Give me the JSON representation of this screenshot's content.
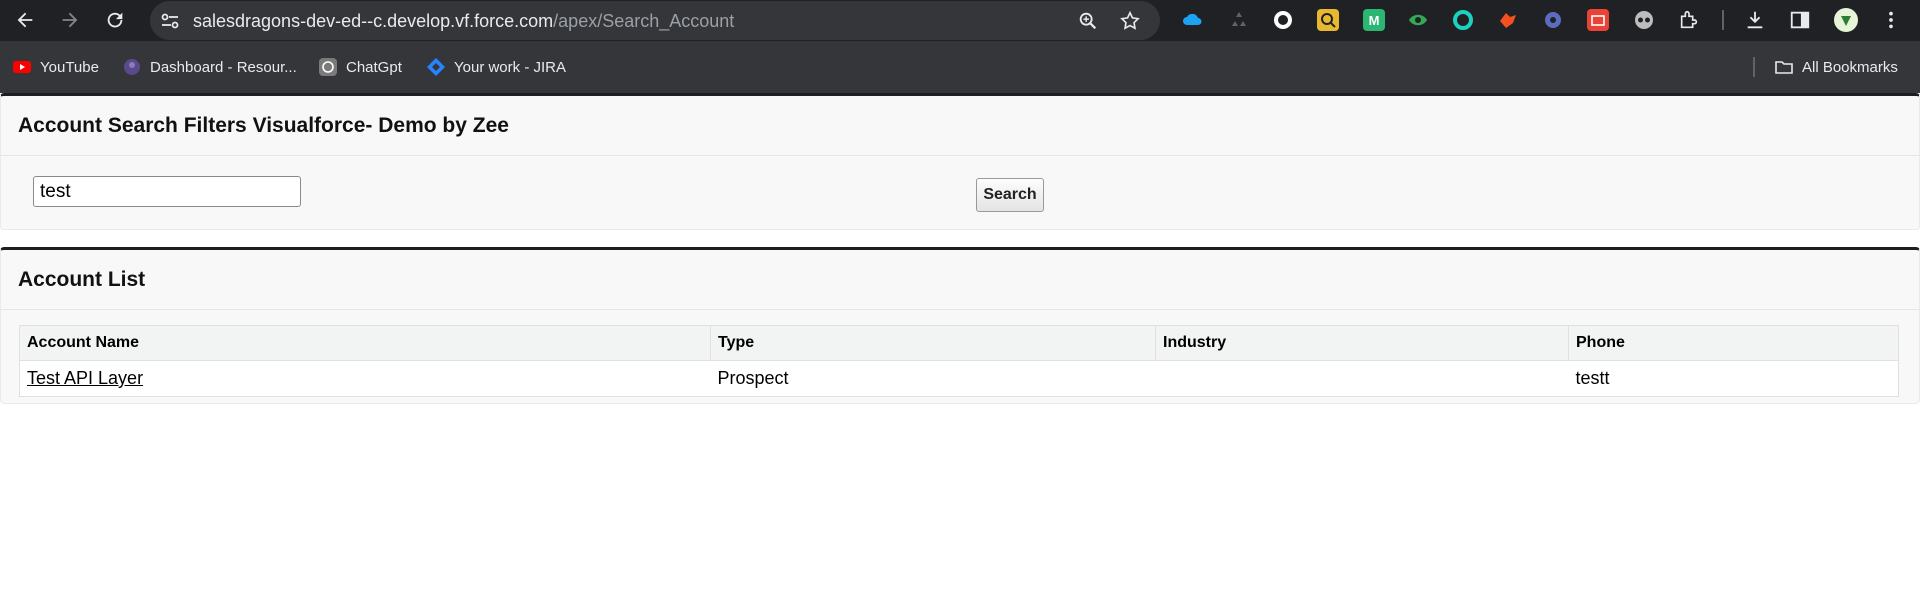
{
  "browser": {
    "url_host": "salesdragons-dev-ed--c.develop.vf.force.com",
    "url_path": "/apex/Search_Account",
    "bookmarks": [
      {
        "label": "YouTube",
        "icon": "youtube-icon"
      },
      {
        "label": "Dashboard - Resour...",
        "icon": "dashboard-icon"
      },
      {
        "label": "ChatGpt",
        "icon": "chatgpt-icon"
      },
      {
        "label": "Your work - JIRA",
        "icon": "jira-icon"
      }
    ],
    "all_bookmarks_label": "All Bookmarks"
  },
  "search_block": {
    "title": "Account Search Filters Visualforce- Demo by Zee",
    "search_value": "test",
    "search_button_label": "Search"
  },
  "account_list": {
    "title": "Account List",
    "columns": [
      "Account Name",
      "Type",
      "Industry",
      "Phone"
    ],
    "rows": [
      {
        "name": "Test API Layer",
        "type": "Prospect",
        "industry": "",
        "phone": "testt"
      }
    ]
  },
  "colors": {
    "chrome_dark": "#202124",
    "bookmark_bar": "#35363a",
    "block_bg": "#f8f8f8",
    "header_row_bg": "#f2f3f3"
  }
}
